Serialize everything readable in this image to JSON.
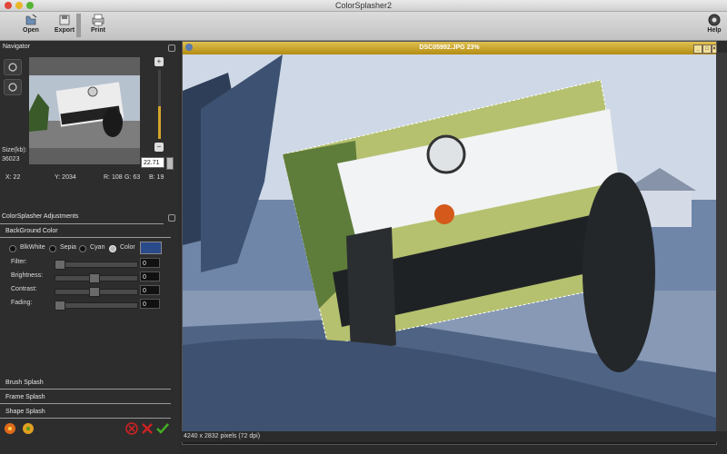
{
  "app": {
    "title": "ColorSplasher2"
  },
  "toolbar": {
    "open": "Open",
    "export": "Export",
    "print": "Print",
    "help": "Help"
  },
  "navigator": {
    "title": "Navigator",
    "size_label": "Size(kb):",
    "size_value": "36023",
    "zoom_value": "22.71",
    "x": "X: 22",
    "y": "Y: 2034",
    "r": "R: 108",
    "g": "G: 63",
    "b": "B: 19"
  },
  "adjustments": {
    "title": "ColorSplasher Adjustments",
    "background_tab": "BackGround Color",
    "modes": [
      "BlkWhite",
      "Sepia",
      "Cyan",
      "Color"
    ],
    "selected_mode": "Color",
    "swatch_color": "#2a4a8a",
    "sliders": [
      {
        "label": "Filter:",
        "value": "0",
        "thumb": 0.0
      },
      {
        "label": "Brightness:",
        "value": "0",
        "thumb": 0.5
      },
      {
        "label": "Contrast:",
        "value": "0",
        "thumb": 0.5
      },
      {
        "label": "Fading:",
        "value": "0",
        "thumb": 0.0
      }
    ]
  },
  "tabs": {
    "brush": "Brush Splash",
    "frame": "Frame Splash",
    "shape": "Shape Splash"
  },
  "document": {
    "title": "DSC05992.JPG 23%",
    "status": "4240 x 2832 pixels (72 dpi)"
  },
  "colors": {
    "doc_title_bar": "#c9a22a",
    "accept": "#44aa22",
    "cancel": "#cc2222"
  }
}
